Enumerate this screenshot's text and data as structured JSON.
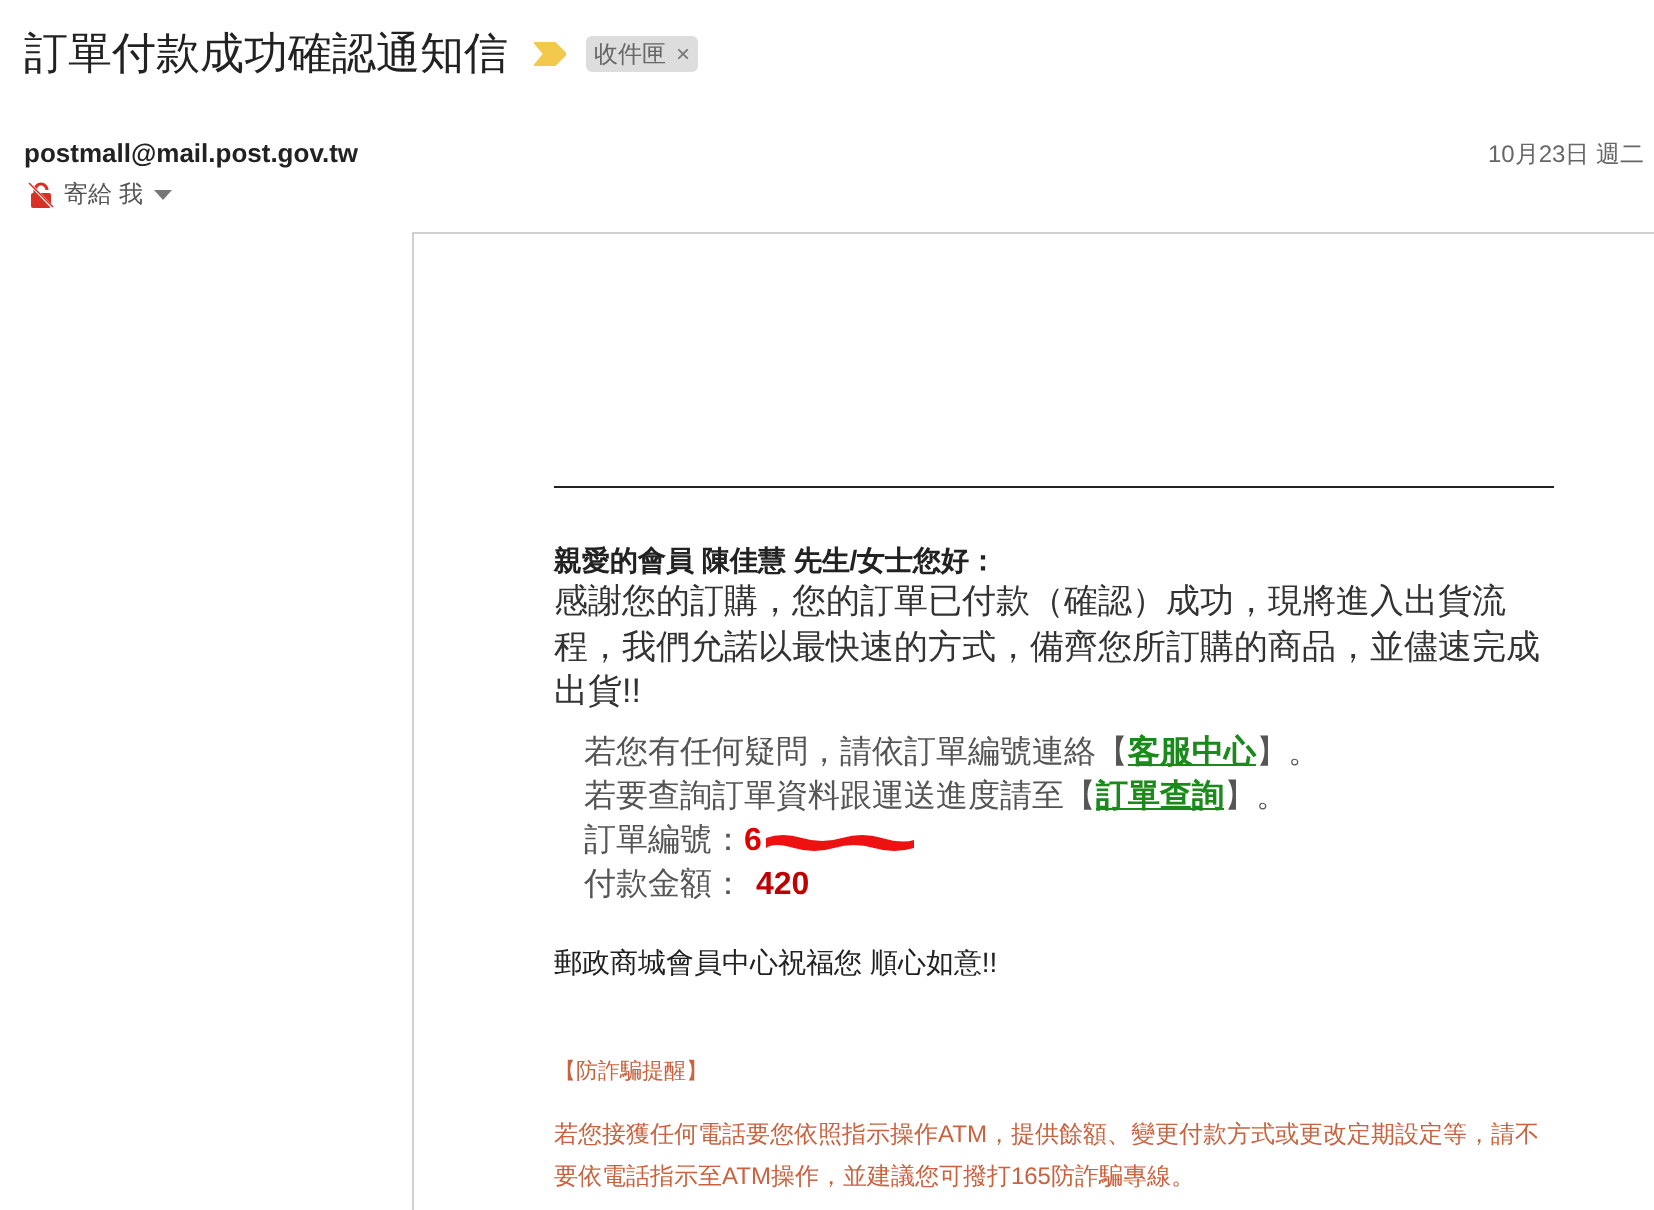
{
  "email": {
    "subject": "訂單付款成功確認通知信",
    "important": true,
    "labels": [
      {
        "name": "收件匣",
        "remove": "×"
      }
    ]
  },
  "sender": {
    "address": "postmall@mail.post.gov.tw",
    "encrypted": false,
    "to": "寄給 我",
    "date": "10月23日 週二"
  },
  "body": {
    "greeting": "親愛的會員 陳佳慧 先生/女士您好：",
    "intro": "感謝您的訂購，您的訂單已付款（確認）成功，現將進入出貨流程，我們允諾以最快速的方式，備齊您所訂購的商品，並儘速完成出貨!!",
    "details": [
      {
        "kind": "link_line",
        "before": "若您有任何疑問，請依訂單編號連絡【",
        "link": "客服中心",
        "after": "】。"
      },
      {
        "kind": "link_line",
        "before": "若要查詢訂單資料跟運送進度請至【",
        "link": "訂單查詢",
        "after": "】。"
      },
      {
        "kind": "field",
        "label": "訂單編號：",
        "value": "6",
        "redacted": true
      },
      {
        "kind": "field",
        "label": "付款金額：",
        "value": "420",
        "redacted": false
      }
    ],
    "closing": "郵政商城會員中心祝福您 順心如意!!",
    "fraud_notice": {
      "title": "【防詐騙提醒】",
      "text": "若您接獲任何電話要您依照指示操作ATM，提供餘額、變更付款方式或更改定期設定等，請不要依電話指示至ATM操作，並建議您可撥打165防詐騙專線。"
    }
  }
}
